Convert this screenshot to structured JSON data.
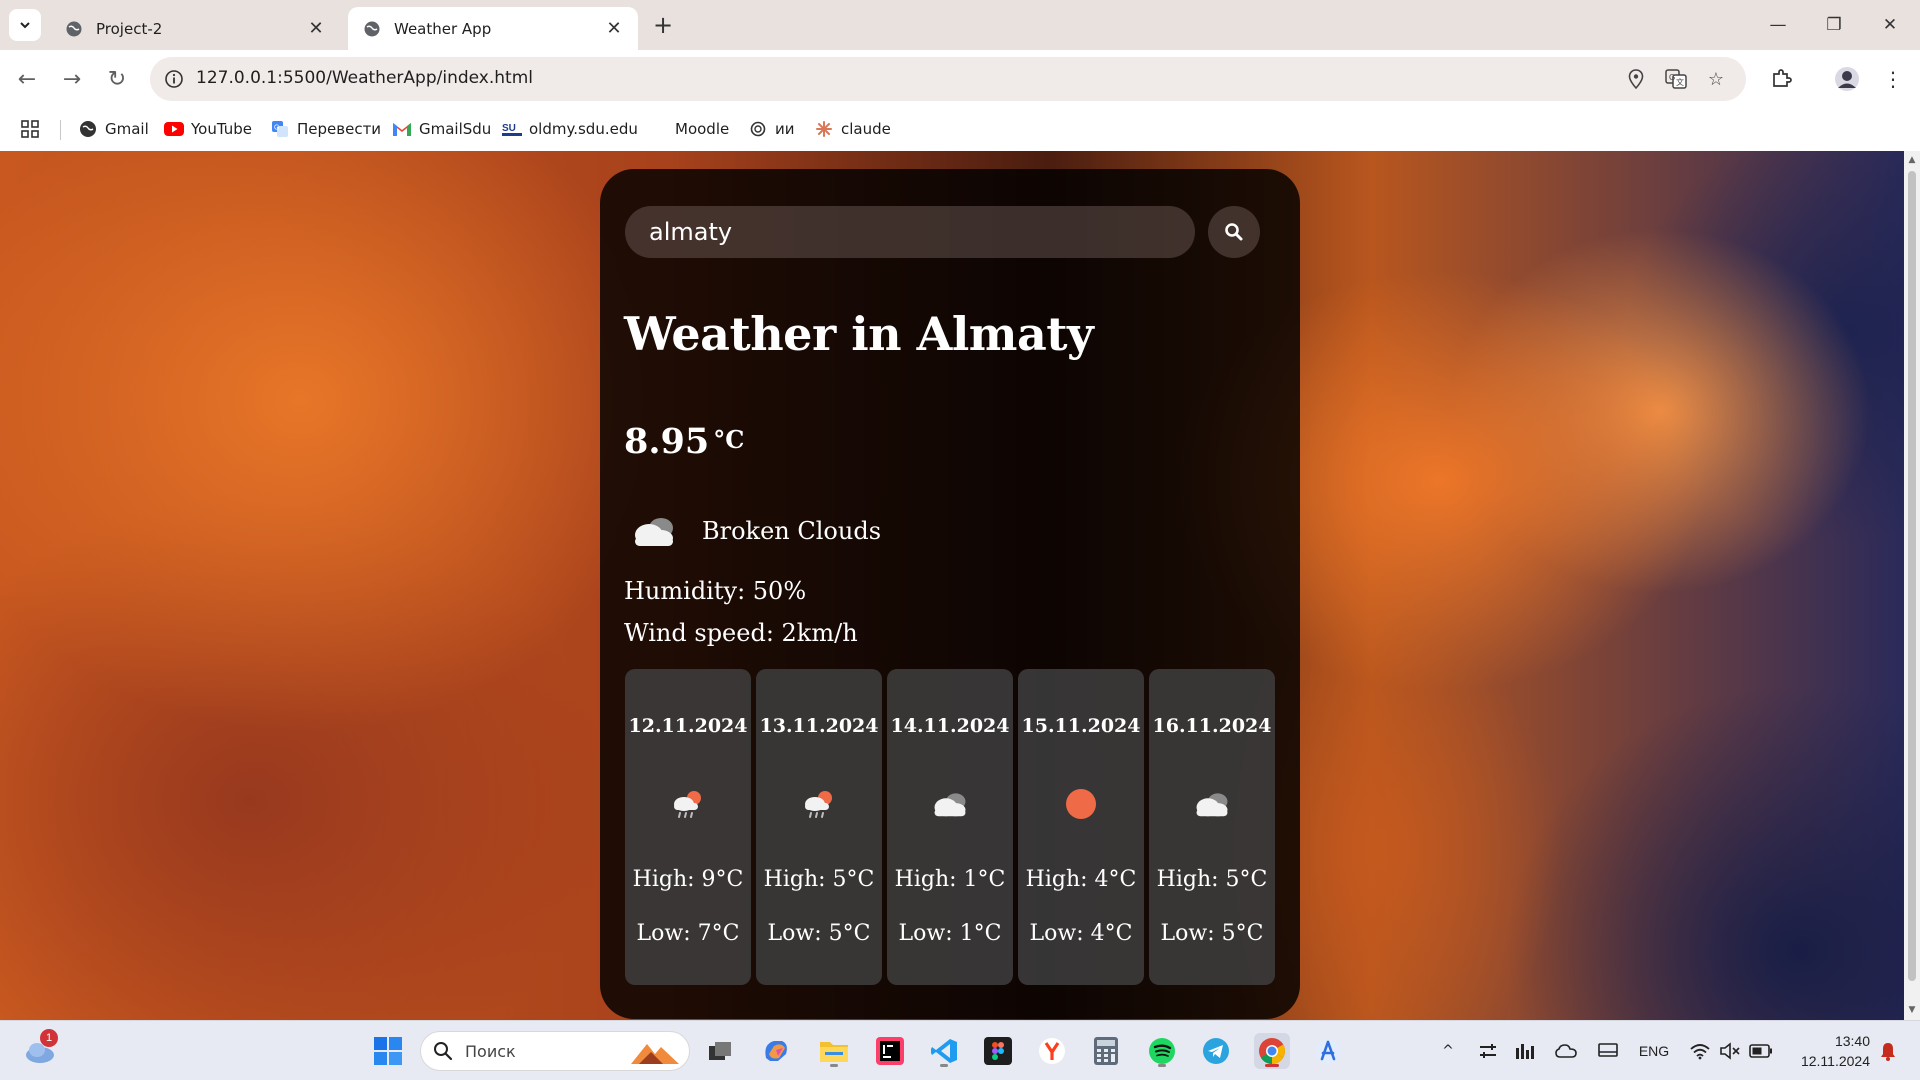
{
  "browser": {
    "tabs": [
      {
        "title": "Project-2"
      },
      {
        "title": "Weather App"
      }
    ],
    "url": "127.0.0.1:5500/WeatherApp/index.html",
    "bookmarks": [
      {
        "label": "Gmail"
      },
      {
        "label": "YouTube"
      },
      {
        "label": "Перевести"
      },
      {
        "label": "GmailSdu"
      },
      {
        "label": "oldmy.sdu.edu"
      },
      {
        "label": "Moodle"
      },
      {
        "label": "ии"
      },
      {
        "label": "claude"
      }
    ]
  },
  "weather": {
    "search_value": "almaty",
    "city_heading": "Weather in Almaty",
    "temperature": "8.95",
    "temperature_unit": "°C",
    "description": "Broken Clouds",
    "humidity": "Humidity: 50%",
    "wind": "Wind speed: 2km/h",
    "forecast": [
      {
        "date": "12.11.2024",
        "high": "High: 9°C",
        "low": "Low: 7°C",
        "icon": "rain-sun-cloud-icon"
      },
      {
        "date": "13.11.2024",
        "high": "High: 5°C",
        "low": "Low: 5°C",
        "icon": "rain-sun-cloud-icon"
      },
      {
        "date": "14.11.2024",
        "high": "High: 1°C",
        "low": "Low: 1°C",
        "icon": "broken-clouds-icon"
      },
      {
        "date": "15.11.2024",
        "high": "High: 4°C",
        "low": "Low: 4°C",
        "icon": "sun-icon"
      },
      {
        "date": "16.11.2024",
        "high": "High: 5°C",
        "low": "Low: 5°C",
        "icon": "broken-clouds-icon"
      }
    ],
    "colors": {
      "card": "#000000",
      "sun": "#ef6a47",
      "text": "#ffffff"
    }
  },
  "taskbar": {
    "search_placeholder": "Поиск",
    "weather_badge": "1",
    "language": "ENG",
    "time": "13:40",
    "date": "12.11.2024"
  }
}
